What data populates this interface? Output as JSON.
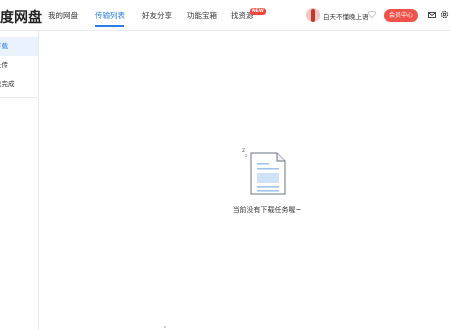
{
  "header": {
    "logo": "度网盘",
    "nav": [
      {
        "label": "我的网盘"
      },
      {
        "label": "传输列表"
      },
      {
        "label": "好友分享"
      },
      {
        "label": "功能宝箱"
      },
      {
        "label": "找资源"
      }
    ],
    "new_badge": "NEW",
    "username": "白天不懂晚上语",
    "vip_button": "会员中心"
  },
  "sidebar": {
    "items": [
      {
        "label": "下载"
      },
      {
        "label": "上传"
      },
      {
        "label": "已完成"
      }
    ]
  },
  "main": {
    "empty_text": "当前没有下载任务喔~"
  },
  "colors": {
    "accent": "#2b7de9",
    "vip": "#f0524a",
    "badge": "#f2463b"
  }
}
